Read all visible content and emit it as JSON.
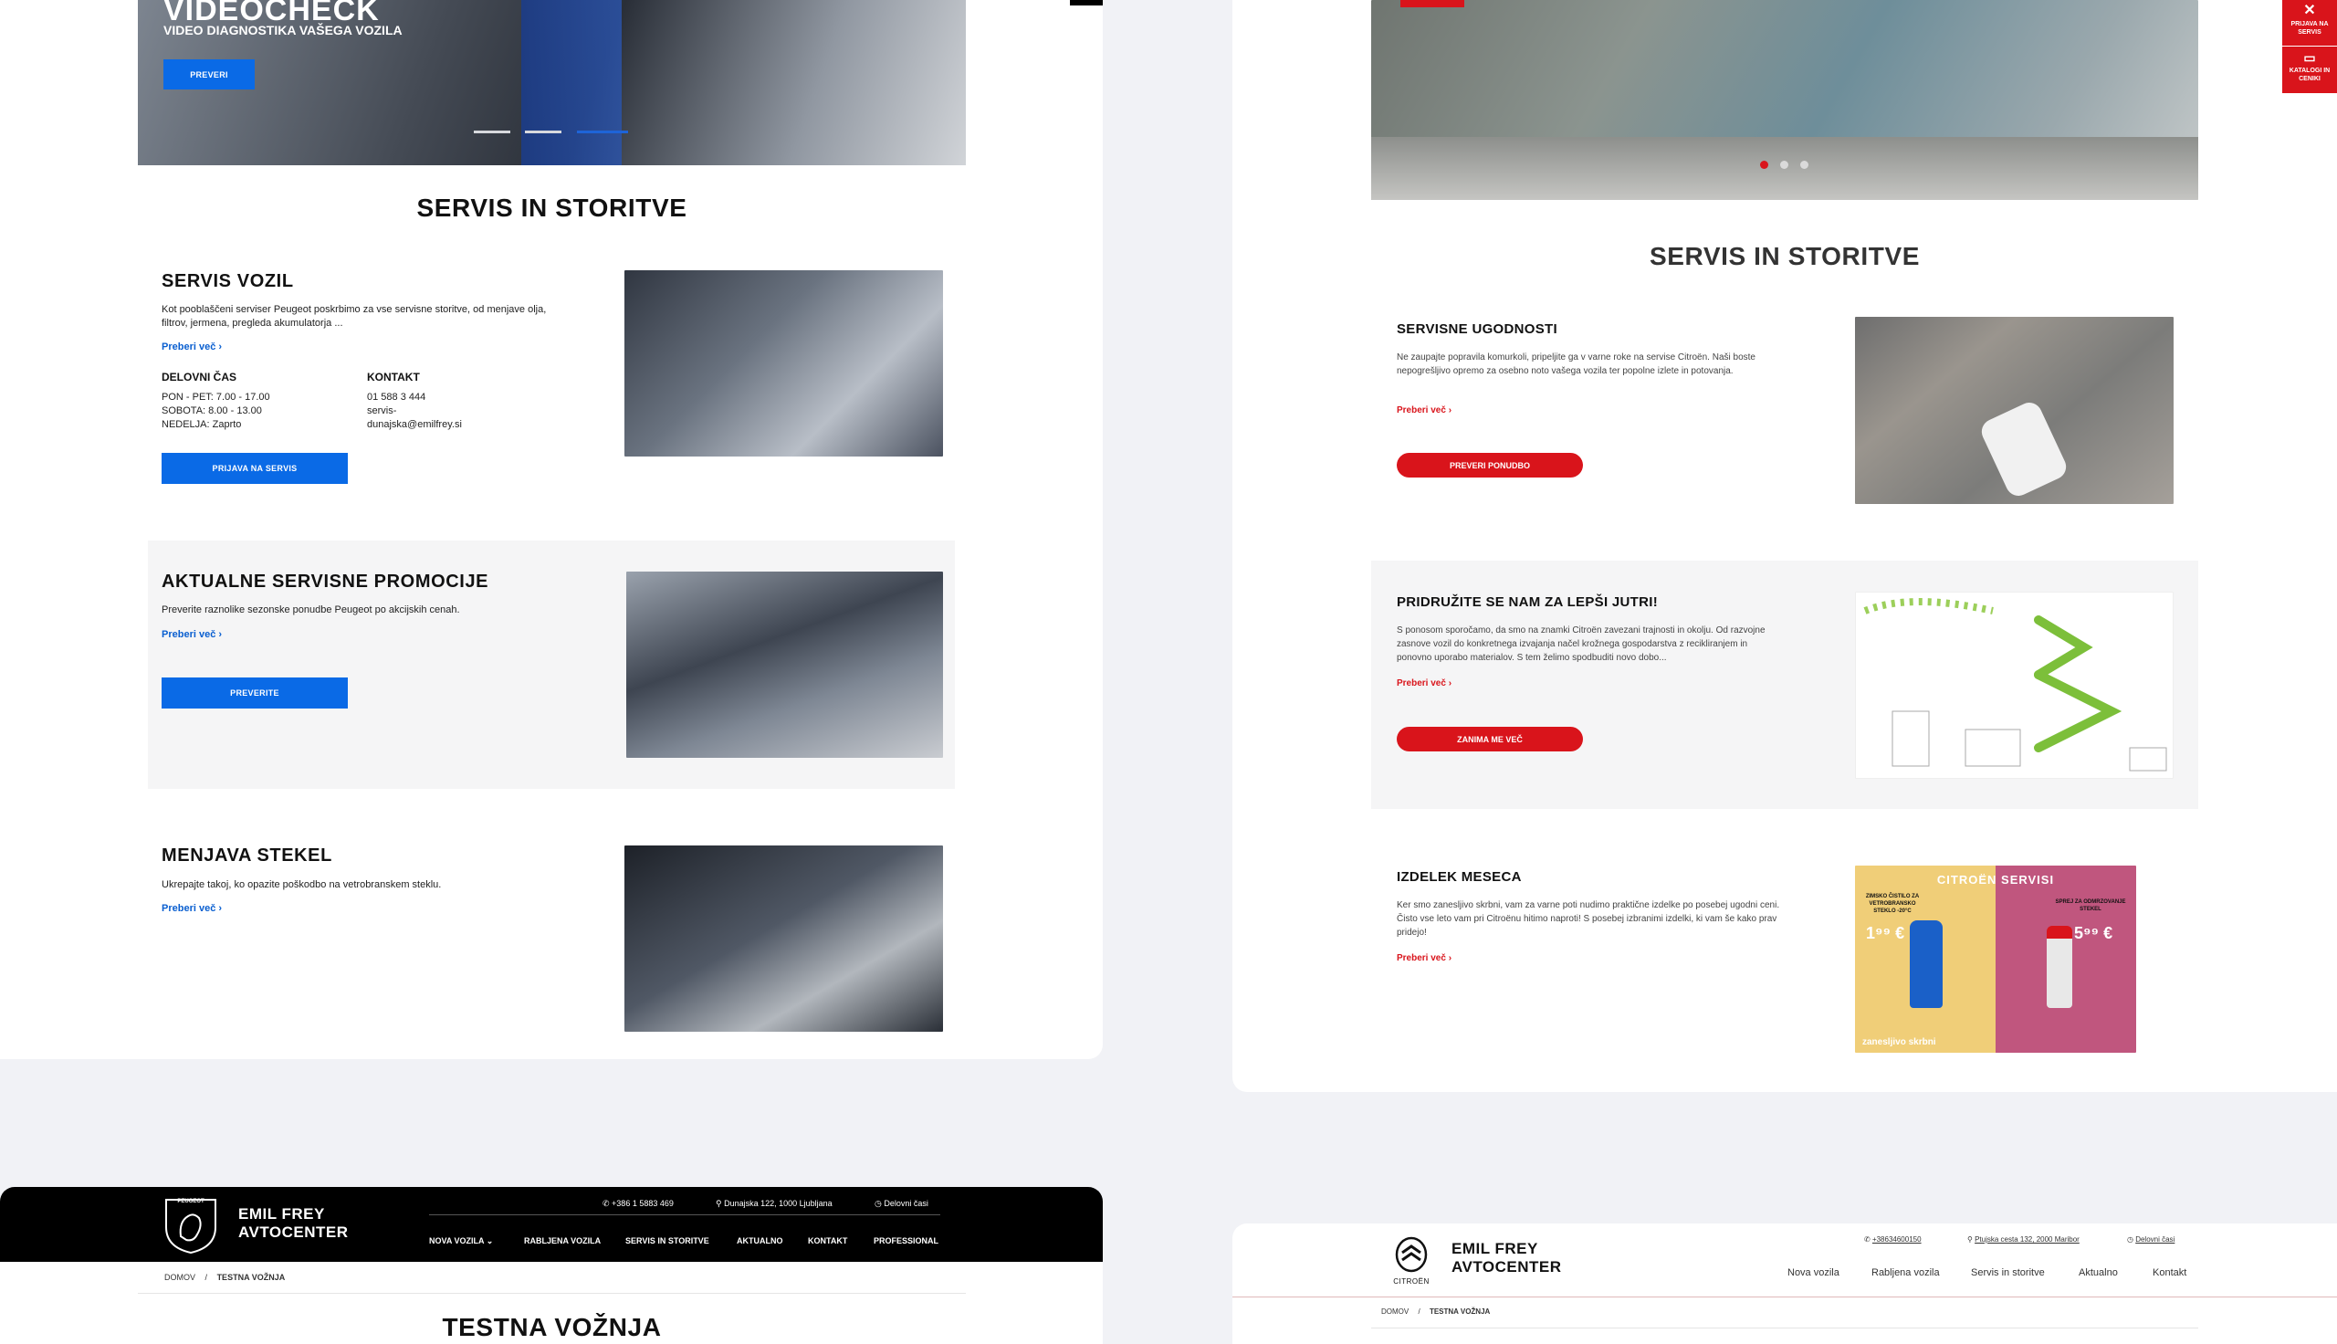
{
  "left": {
    "hero": {
      "title": "VIDEOCHECK",
      "subtitle": "VIDEO DIAGNOSTIKA VAŠEGA VOZILA",
      "button": "PREVERI"
    },
    "section_title": "SERVIS IN STORITVE",
    "services": [
      {
        "title": "SERVIS VOZIL",
        "text": "Kot pooblaščeni serviser Peugeot poskrbimo za vse servisne storitve, od menjave olja, filtrov, jermena, pregleda akumulatorja ...",
        "more": "Preberi več",
        "hours_label": "DELOVNI ČAS",
        "hours": [
          "PON - PET: 7.00 - 17.00",
          "SOBOTA: 8.00 - 13.00",
          "NEDELJA: Zaprto"
        ],
        "contact_label": "KONTAKT",
        "contact": [
          "01 588 3 444",
          "servis-",
          "dunajska@emilfrey.si"
        ],
        "button": "PRIJAVA NA SERVIS"
      },
      {
        "title": "AKTUALNE SERVISNE PROMOCIJE",
        "text": "Preverite raznolike sezonske ponudbe Peugeot po akcijskih cenah.",
        "more": "Preberi več",
        "button": "PREVERITE"
      },
      {
        "title": "MENJAVA STEKEL",
        "text": "Ukrepajte takoj, ko opazite poškodbo na vetrobranskem steklu.",
        "more": "Preberi več"
      }
    ],
    "header": {
      "phone": "+386 1 5883 469",
      "address": "Dunajska 122, 1000 Ljubljana",
      "hours": "Delovni časi",
      "brand_line1": "EMIL FREY",
      "brand_line2": "AVTOCENTER",
      "logo_text": "PEUGEOT",
      "nav": [
        "NOVA VOZILA",
        "RABLJENA VOZILA",
        "SERVIS IN STORITVE",
        "AKTUALNO",
        "KONTAKT",
        "PROFESSIONAL"
      ]
    },
    "breadcrumb": [
      "DOMOV",
      "/",
      "TESTNA VOŽNJA"
    ],
    "page_title": "TESTNA VOŽNJA"
  },
  "right": {
    "side_tabs": [
      "PRIJAVA NA SERVIS",
      "KATALOGI IN CENIKI"
    ],
    "section_title": "SERVIS IN STORITVE",
    "services": [
      {
        "title": "SERVISNE UGODNOSTI",
        "text": "Ne zaupajte popravila komurkoli, pripeljite ga v varne roke na servise Citroën. Naši boste nepogrešljivo opremo za osebno noto vašega vozila ter popolne izlete in potovanja.",
        "more": "Preberi več",
        "button": "PREVERI PONUDBO"
      },
      {
        "title": "PRIDRUŽITE SE NAM ZA LEPŠI JUTRI!",
        "text": "S ponosom sporočamo, da smo na znamki Citroën zavezani trajnosti in okolju. Od razvojne zasnove vozil do konkretnega izvajanja načel krožnega gospodarstva z recikliranjem in ponovno uporabo materialov. S tem želimo spodbuditi novo dobo...",
        "more": "Preberi več",
        "button": "ZANIMA ME VEČ"
      },
      {
        "title": "IZDELEK MESECA",
        "text": "Ker smo zanesljivo skrbni, vam za varne poti nudimo praktične izdelke po posebej ugodni ceni. Čisto vse leto vam pri Citroënu hitimo naproti! S posebej izbranimi izdelki, ki vam še kako prav pridejo!",
        "more": "Preberi več",
        "promo_header": "CITROËN SERVISI",
        "promo_left_label": "ZIMSKO ČISTILO ZA VETROBRANSKO STEKLO -20°C",
        "promo_left_price": "1⁹⁹ €",
        "promo_right_label": "SPREJ ZA ODMRZOVANJE STEKEL",
        "promo_right_price": "5⁹⁹ €",
        "promo_footer": "zanesljivo skrbni"
      }
    ],
    "header": {
      "phone": "+38634600150",
      "address": "Ptujska cesta 132, 2000 Maribor",
      "hours": "Delovni časi",
      "brand_line1": "EMIL FREY",
      "brand_line2": "AVTOCENTER",
      "logo_text": "CITROËN",
      "nav": [
        "Nova vozila",
        "Rabljena vozila",
        "Servis in storitve",
        "Aktualno",
        "Kontakt"
      ]
    },
    "breadcrumb": [
      "DOMOV",
      "/",
      "TESTNA VOŽNJA"
    ]
  },
  "colors": {
    "peugeot_blue": "#0a6ae6",
    "citroen_red": "#d9141b",
    "background": "#f1f2f6"
  }
}
